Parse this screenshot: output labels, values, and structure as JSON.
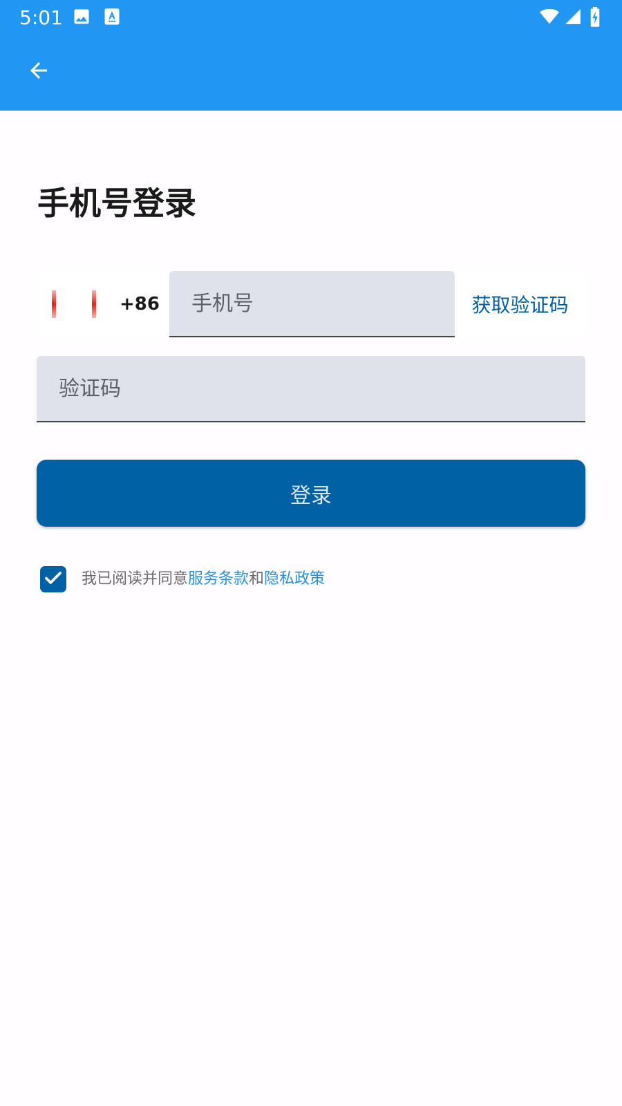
{
  "status_bar": {
    "time": "5:01",
    "left_icons": [
      "image-icon",
      "text-a-icon"
    ],
    "right_icons": [
      "wifi-icon",
      "signal-icon",
      "battery-charging-icon"
    ]
  },
  "app_bar": {
    "back_icon": "arrow-back-icon",
    "color": "#2296f3"
  },
  "page": {
    "title": "手机号登录"
  },
  "phone_row": {
    "country_flag": "cn-flag-icon",
    "dial_code": "+86",
    "phone_placeholder": "手机号",
    "phone_value": "",
    "get_code_label": "获取验证码"
  },
  "code_field": {
    "placeholder": "验证码",
    "value": ""
  },
  "login_button": {
    "label": "登录",
    "color": "#0061a4"
  },
  "agreement": {
    "checked": true,
    "prefix": "我已阅读并同意",
    "terms_link": "服务条款",
    "and_text": "和",
    "privacy_link": "隐私政策",
    "link_color": "#2a8fe0"
  }
}
